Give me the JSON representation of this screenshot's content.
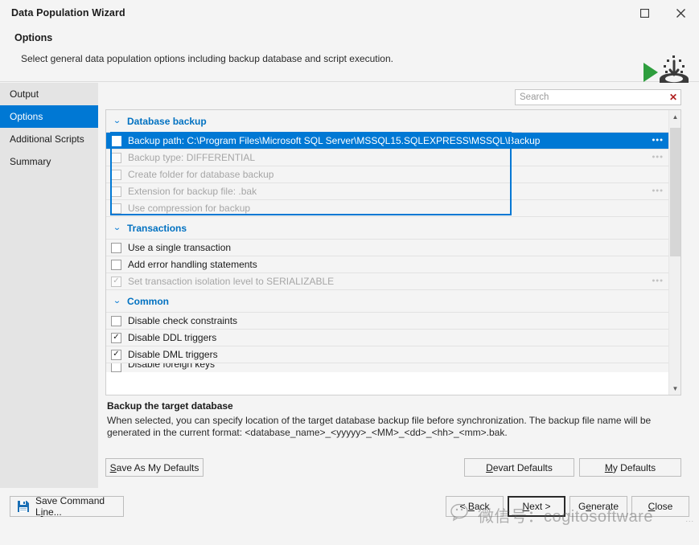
{
  "window": {
    "title": "Data Population Wizard",
    "maximize_label": "Maximize",
    "close_label": "Close"
  },
  "header": {
    "title": "Options",
    "subtitle": "Select general data population options including backup database and script execution.",
    "logo_name": "data-population-logo"
  },
  "sidebar": {
    "items": [
      {
        "label": "Output",
        "active": false
      },
      {
        "label": "Options",
        "active": true
      },
      {
        "label": "Additional Scripts",
        "active": false
      },
      {
        "label": "Summary",
        "active": false
      }
    ]
  },
  "search": {
    "value": "",
    "placeholder": "Search",
    "clear_label": "✕"
  },
  "options_list": {
    "groups": [
      {
        "label": "Database backup",
        "expanded": true,
        "chevron": "⌄",
        "rows": [
          {
            "label": "Backup path: C:\\Program Files\\Microsoft SQL Server\\MSSQL15.SQLEXPRESS\\MSSQL\\Backup",
            "checked": false,
            "disabled": false,
            "selected": true,
            "ellipsis": "•••"
          },
          {
            "label": "Backup type: DIFFERENTIAL",
            "checked": false,
            "disabled": true,
            "selected": false,
            "ellipsis": "•••"
          },
          {
            "label": "Create folder for database backup",
            "checked": false,
            "disabled": true,
            "selected": false,
            "ellipsis": ""
          },
          {
            "label": "Extension for backup file: .bak",
            "checked": false,
            "disabled": true,
            "selected": false,
            "ellipsis": "•••"
          },
          {
            "label": "Use compression for backup",
            "checked": false,
            "disabled": true,
            "selected": false,
            "ellipsis": ""
          }
        ]
      },
      {
        "label": "Transactions",
        "expanded": true,
        "chevron": "⌄",
        "rows": [
          {
            "label": "Use a single transaction",
            "checked": false,
            "disabled": false,
            "selected": false,
            "ellipsis": ""
          },
          {
            "label": "Add error handling statements",
            "checked": false,
            "disabled": false,
            "selected": false,
            "ellipsis": ""
          },
          {
            "label": "Set transaction isolation level to SERIALIZABLE",
            "checked": true,
            "disabled": true,
            "selected": false,
            "ellipsis": "•••"
          }
        ]
      },
      {
        "label": "Common",
        "expanded": true,
        "chevron": "⌄",
        "rows": [
          {
            "label": "Disable check constraints",
            "checked": false,
            "disabled": false,
            "selected": false,
            "ellipsis": ""
          },
          {
            "label": "Disable DDL triggers",
            "checked": true,
            "disabled": false,
            "selected": false,
            "ellipsis": ""
          },
          {
            "label": "Disable DML triggers",
            "checked": true,
            "disabled": false,
            "selected": false,
            "ellipsis": ""
          },
          {
            "label": "Disable foreign keys",
            "checked": false,
            "disabled": false,
            "selected": false,
            "ellipsis": "",
            "clipped": true
          }
        ]
      }
    ],
    "check_glyph": "✓",
    "scroll_up": "▲",
    "scroll_down": "▼"
  },
  "description": {
    "title": "Backup the target database",
    "body": "When selected, you can specify location of the target database backup file before synchronization. The backup file name will be generated in the current format: <database_name>_<yyyyy>_<MM>_<dd>_<hh>_<mm>.bak."
  },
  "defaults_buttons": [
    {
      "name": "save-as-my-defaults-button",
      "pre": "",
      "accel": "S",
      "post": "ave As My Defaults"
    },
    {
      "name": "devart-defaults-button",
      "pre": "",
      "accel": "D",
      "post": "evart Defaults"
    },
    {
      "name": "my-defaults-button",
      "pre": "",
      "accel": "M",
      "post": "y Defaults"
    }
  ],
  "bottom_bar": {
    "save_command_line": {
      "pre": "Save Command L",
      "accel": "i",
      "post": "ne..."
    },
    "nav_buttons": [
      {
        "name": "back-button",
        "pre": "< ",
        "accel": "B",
        "post": "ack",
        "focused": false
      },
      {
        "name": "next-button",
        "pre": "",
        "accel": "N",
        "post": "ext >",
        "focused": true
      },
      {
        "name": "generate-button",
        "pre": "G",
        "accel": "e",
        "post": "nerate",
        "focused": false
      },
      {
        "name": "close-button",
        "pre": "",
        "accel": "C",
        "post": "lose",
        "focused": false
      }
    ]
  },
  "watermark": {
    "text": "微信号：cogitosoftware"
  },
  "colors": {
    "accent_blue": "#0078d4",
    "group_label_blue": "#0071c1",
    "window_bg": "#f4f4f4",
    "sidebar_bg": "#e4e4e4",
    "clear_red": "#b02020"
  }
}
